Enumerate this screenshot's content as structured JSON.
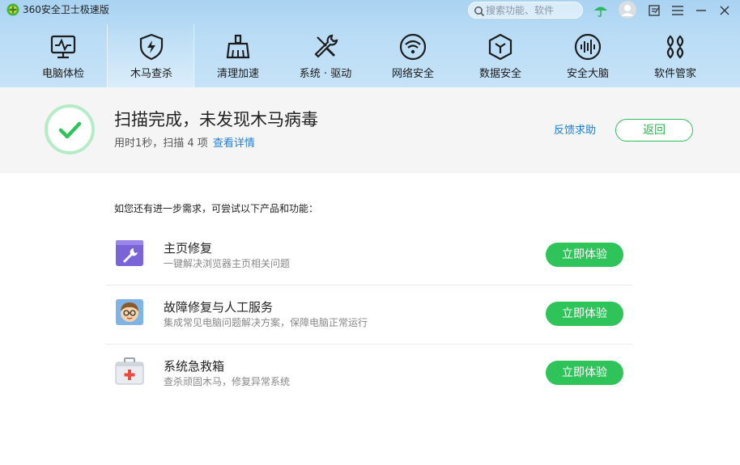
{
  "app": {
    "title": "360安全卫士极速版",
    "accent_color": "#2ec45a",
    "link_color": "#1e7fd2"
  },
  "search": {
    "placeholder": "搜索功能、软件"
  },
  "titlebar_icons": [
    "skin-umbrella-icon",
    "avatar-icon",
    "feedback-edit-icon",
    "menu-icon",
    "minimize-icon",
    "close-icon"
  ],
  "nav": {
    "items": [
      {
        "label": "电脑体检",
        "icon": "monitor-pulse-icon"
      },
      {
        "label": "木马查杀",
        "icon": "shield-bolt-icon",
        "active": true
      },
      {
        "label": "清理加速",
        "icon": "broom-icon"
      },
      {
        "label": "系统 · 驱动",
        "icon": "wrench-screwdriver-icon"
      },
      {
        "label": "网络安全",
        "icon": "wifi-icon"
      },
      {
        "label": "数据安全",
        "icon": "cube-icon"
      },
      {
        "label": "安全大脑",
        "icon": "brain-wave-icon"
      },
      {
        "label": "软件管家",
        "icon": "software-grid-icon"
      }
    ]
  },
  "result": {
    "title": "扫描完成，未发现木马病毒",
    "summary": "用时1秒，扫描 4 项",
    "details_link": "查看详情",
    "feedback_link": "反馈求助",
    "back_button": "返回"
  },
  "recommendations": {
    "intro": "如您还有进一步需求，可尝试以下产品和功能：",
    "items": [
      {
        "title": "主页修复",
        "desc": "一键解决浏览器主页相关问题",
        "button": "立即体验",
        "icon": "homepage-repair-wrench-icon"
      },
      {
        "title": "故障修复与人工服务",
        "desc": "集成常见电脑问题解决方案，保障电脑正常运行",
        "button": "立即体验",
        "icon": "support-engineer-icon"
      },
      {
        "title": "系统急救箱",
        "desc": "查杀顽固木马，修复异常系统",
        "button": "立即体验",
        "icon": "first-aid-kit-icon"
      }
    ]
  }
}
